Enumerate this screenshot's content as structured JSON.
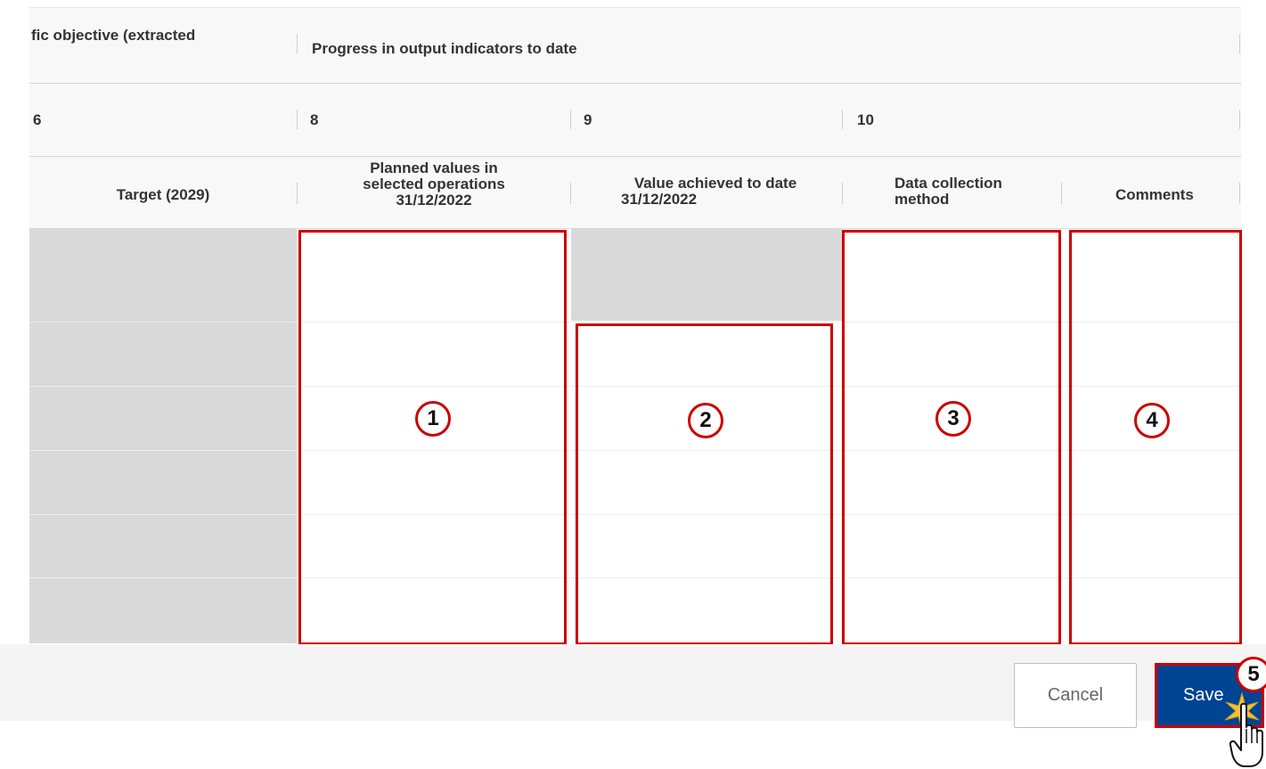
{
  "header": {
    "partial_objective": "fic objective (extracted",
    "progress_group": "Progress in output indicators to date"
  },
  "column_numbers": [
    "6",
    "8",
    "9",
    "10"
  ],
  "columns": {
    "target": "Target (2029)",
    "planned_l1": "Planned values in",
    "planned_l2": "selected operations",
    "planned_l3": "31/12/2022",
    "achieved_l1": "Value achieved to date",
    "achieved_l2": "31/12/2022",
    "method_l1": "Data collection",
    "method_l2": "method",
    "comments": "Comments"
  },
  "callouts": [
    "1",
    "2",
    "3",
    "4",
    "5"
  ],
  "footer": {
    "cancel_label": "Cancel",
    "save_label": "Save"
  },
  "colors": {
    "save_bg": "#004494",
    "highlight": "#cc0000",
    "disabled_cell": "#d9d9d9"
  },
  "icons": [
    "hand-pointer-icon",
    "click-burst-icon"
  ]
}
